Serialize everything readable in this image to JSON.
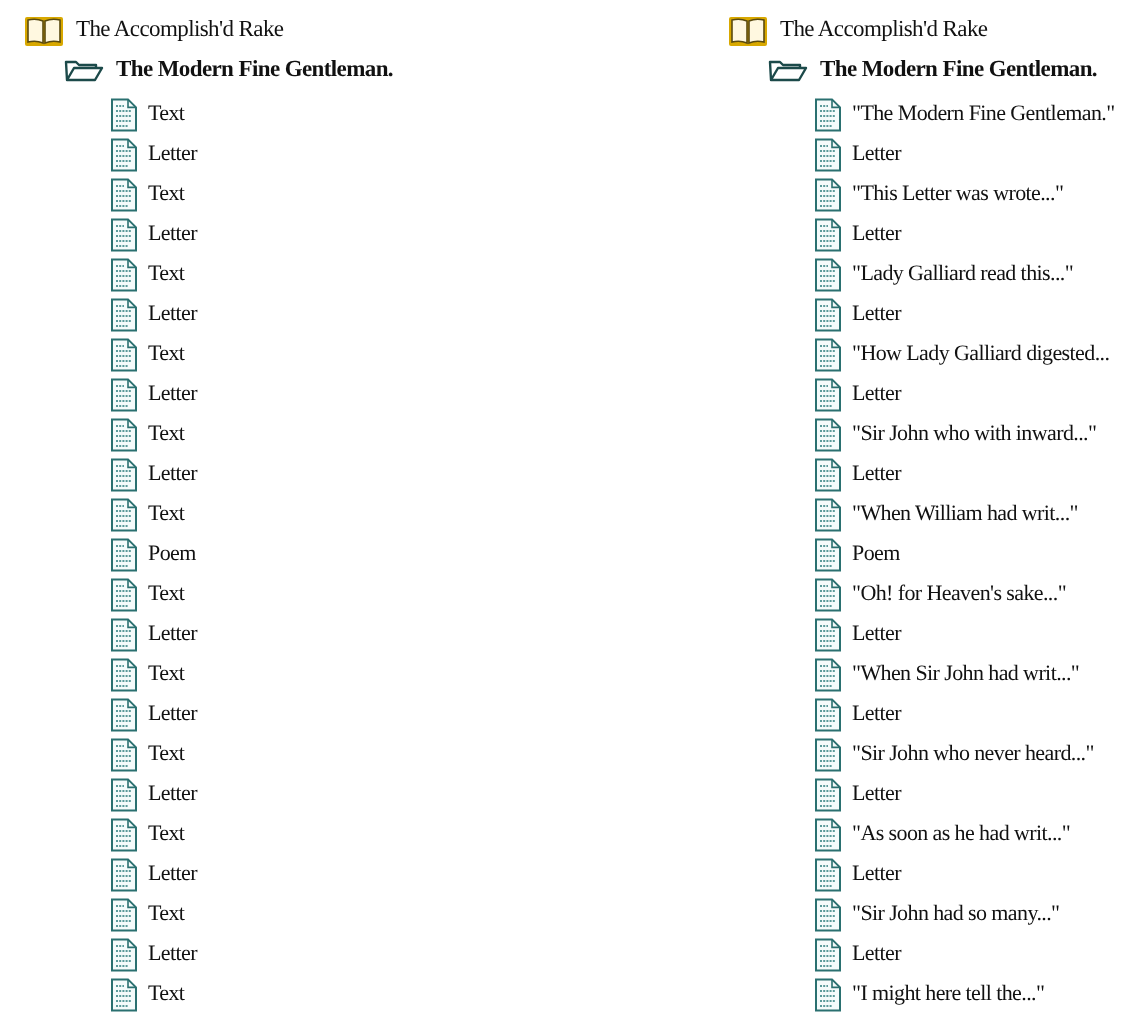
{
  "panels": [
    {
      "title": "The Accomplish'd Rake",
      "children": [
        {
          "title": "The Modern Fine Gentleman.",
          "expanded": true,
          "children": [
            {
              "title": "Text"
            },
            {
              "title": "Letter"
            },
            {
              "title": "Text"
            },
            {
              "title": "Letter"
            },
            {
              "title": "Text"
            },
            {
              "title": "Letter"
            },
            {
              "title": "Text"
            },
            {
              "title": "Letter"
            },
            {
              "title": "Text"
            },
            {
              "title": "Letter"
            },
            {
              "title": "Text"
            },
            {
              "title": "Poem"
            },
            {
              "title": "Text"
            },
            {
              "title": "Letter"
            },
            {
              "title": "Text"
            },
            {
              "title": "Letter"
            },
            {
              "title": "Text"
            },
            {
              "title": "Letter"
            },
            {
              "title": "Text"
            },
            {
              "title": "Letter"
            },
            {
              "title": "Text"
            },
            {
              "title": "Letter"
            },
            {
              "title": "Text"
            }
          ]
        }
      ]
    },
    {
      "title": "The Accomplish'd Rake",
      "children": [
        {
          "title": "The Modern Fine Gentleman.",
          "expanded": true,
          "children": [
            {
              "title": "\"The Modern Fine Gentleman.\""
            },
            {
              "title": "Letter"
            },
            {
              "title": "\"This Letter was wrote...\""
            },
            {
              "title": "Letter"
            },
            {
              "title": "\"Lady Galliard read this...\""
            },
            {
              "title": "Letter"
            },
            {
              "title": "\"How Lady Galliard digested..."
            },
            {
              "title": "Letter"
            },
            {
              "title": "\"Sir John who with inward...\""
            },
            {
              "title": "Letter"
            },
            {
              "title": "\"When William had writ...\""
            },
            {
              "title": "Poem"
            },
            {
              "title": "\"Oh! for Heaven's sake...\""
            },
            {
              "title": "Letter"
            },
            {
              "title": "\"When Sir John had writ...\""
            },
            {
              "title": "Letter"
            },
            {
              "title": "\"Sir John who never heard...\""
            },
            {
              "title": "Letter"
            },
            {
              "title": "\"As soon as he had writ...\""
            },
            {
              "title": "Letter"
            },
            {
              "title": "\"Sir John had so many...\""
            },
            {
              "title": "Letter"
            },
            {
              "title": "\"I might here tell the...\""
            }
          ]
        }
      ]
    }
  ]
}
